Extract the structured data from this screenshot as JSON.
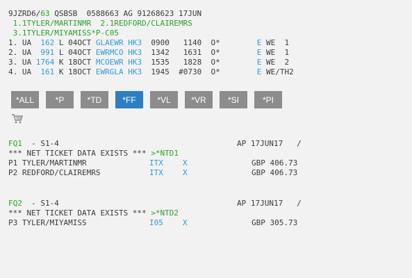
{
  "pnr": {
    "header": {
      "a": "9JZRD6/",
      "b": "63",
      "c": " QSBSB  0588663 AG 91268623 17JUN"
    },
    "names": [
      " 1.1TYLER/MARTINMR  2.1REDFORD/CLAIREMRS",
      " 3.1TYLER/MIYAMISS*P-C05"
    ],
    "segments": [
      {
        "num": "1.",
        "al": " UA ",
        "fl": " 162",
        "cls": " L ",
        "dt": "04OCT",
        "rt": " GLAEWR",
        "st": " HK3",
        "dep": "  0900",
        "arr": "   1140",
        "o": "  O*",
        "pad": "        ",
        "e": "E",
        "day": " WE  1"
      },
      {
        "num": "2.",
        "al": " UA ",
        "fl": " 991",
        "cls": " L ",
        "dt": "04OCT",
        "rt": " EWRMCO",
        "st": " HK3",
        "dep": "  1342",
        "arr": "   1631",
        "o": "  O*",
        "pad": "        ",
        "e": "E",
        "day": " WE  1"
      },
      {
        "num": "3.",
        "al": " UA ",
        "fl": "1764",
        "cls": " K ",
        "dt": "18OCT",
        "rt": " MCOEWR",
        "st": " HK3",
        "dep": "  1535",
        "arr": "   1828",
        "o": "  O*",
        "pad": "        ",
        "e": "E",
        "day": " WE  2"
      },
      {
        "num": "4.",
        "al": " UA ",
        "fl": " 161",
        "cls": " K ",
        "dt": "18OCT",
        "rt": " EWRGLA",
        "st": " HK3",
        "dep": "  1945",
        "arr": "  #0730",
        "o": "  O*",
        "pad": "        ",
        "e": "E",
        "day": " WE/TH2"
      }
    ]
  },
  "toolbar": {
    "buttons": [
      "*ALL",
      "*P",
      "*TD",
      "*FF",
      "*VL",
      "*VR",
      "*SI",
      "*PI"
    ],
    "active": "*FF"
  },
  "fares": [
    {
      "fq": "FQ1",
      "range": "  - S1-4",
      "ap": "AP 17JUN17   /",
      "net_text": "*** NET TICKET DATA EXISTS *** ",
      "net_cmd": ">*NTD1",
      "pax": [
        {
          "p": "P1 TYLER/MARTINMR",
          "fare": "ITX",
          "x": "X",
          "amt": "GBP 406.73"
        },
        {
          "p": "P2 REDFORD/CLAIREMRS",
          "fare": "ITX",
          "x": "X",
          "amt": "GBP 406.73"
        }
      ]
    },
    {
      "fq": "FQ2",
      "range": "  - S1-4",
      "ap": "AP 17JUN17   /",
      "net_text": "*** NET TICKET DATA EXISTS *** ",
      "net_cmd": ">*NTD2",
      "pax": [
        {
          "p": "P3 TYLER/MIYAMISS",
          "fare": "I05",
          "x": "X",
          "amt": "GBP 305.73"
        }
      ]
    }
  ],
  "icons": {
    "cart": "shopping-cart-icon"
  },
  "colors": {
    "green": "#2aa02a",
    "blue": "#2e9bd8",
    "active_button": "#2f7ec2",
    "button": "#8c8c8c"
  }
}
